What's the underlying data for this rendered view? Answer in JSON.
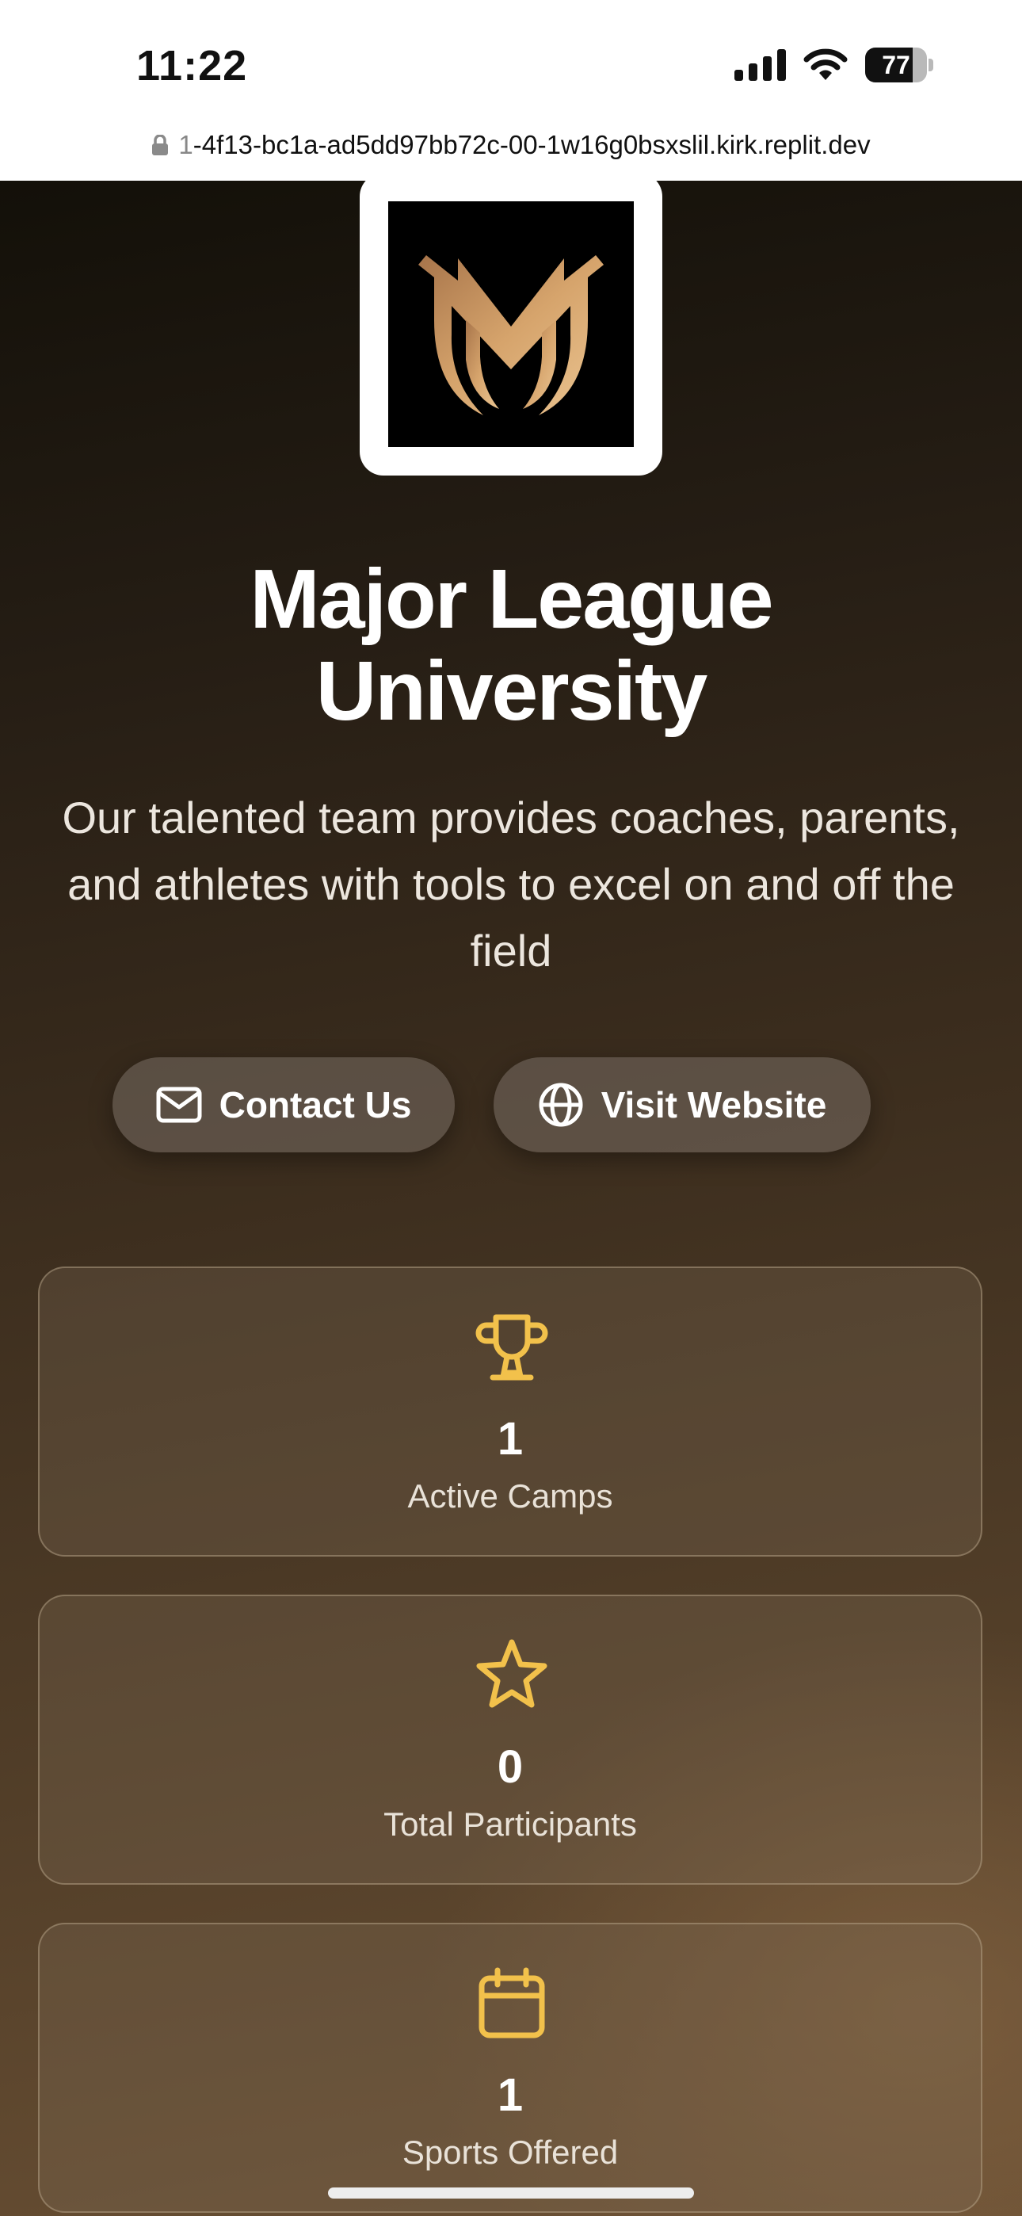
{
  "status_bar": {
    "time": "11:22",
    "battery_level": "77"
  },
  "browser": {
    "url_prefix": "1",
    "url_rest": "-4f13-bc1a-ad5dd97bb72c-00-1w16g0bsxslil.kirk.replit.dev"
  },
  "hero": {
    "title_line1": "Major League",
    "title_line2": "University",
    "subtitle": "Our talented team provides coaches, parents, and athletes with tools to excel on and off the field"
  },
  "actions": {
    "contact_label": "Contact Us",
    "website_label": "Visit Website"
  },
  "stats": [
    {
      "icon": "trophy-icon",
      "value": "1",
      "label": "Active Camps"
    },
    {
      "icon": "star-icon",
      "value": "0",
      "label": "Total Participants"
    },
    {
      "icon": "calendar-icon",
      "value": "1",
      "label": "Sports Offered"
    }
  ],
  "colors": {
    "accent": "#F2C14B",
    "logo_gold": "#C9965E"
  }
}
